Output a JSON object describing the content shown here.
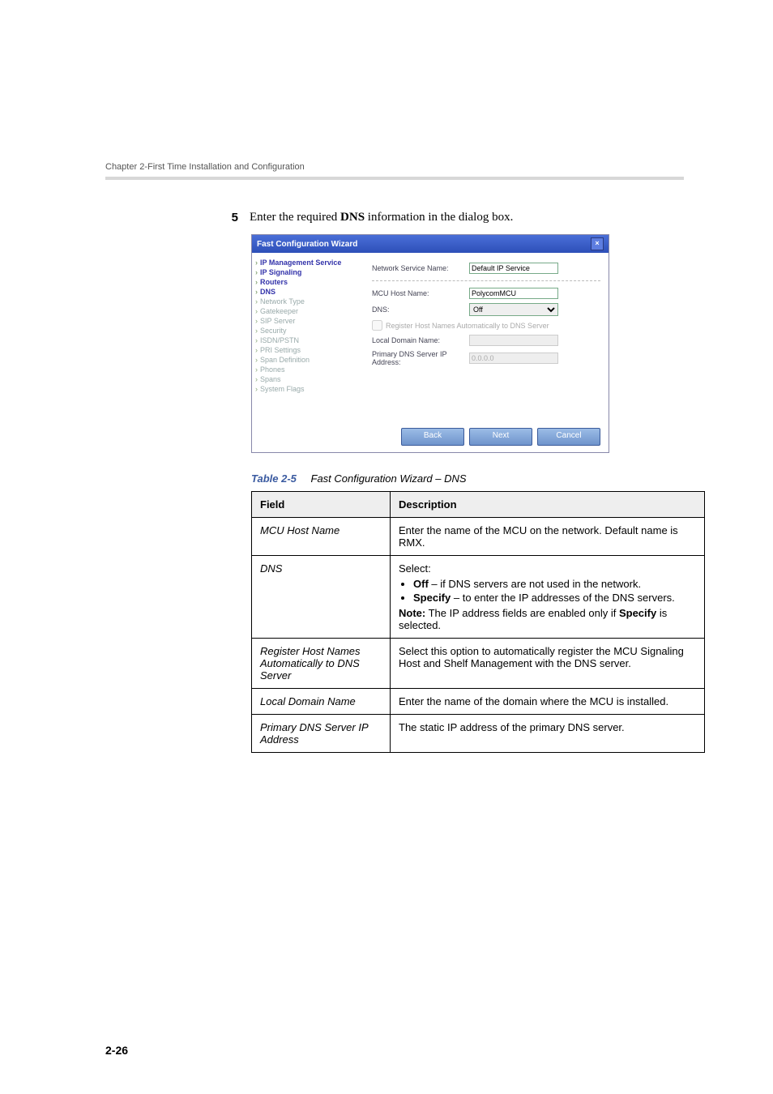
{
  "header": {
    "running_head": "Chapter 2-First Time Installation and Configuration"
  },
  "step": {
    "number": "5",
    "pre": "Enter the required ",
    "bold": "DNS",
    "post": " information in the dialog box."
  },
  "wizard": {
    "title": "Fast Configuration Wizard",
    "close": "×",
    "nav": [
      {
        "label": "IP Management Service",
        "state": "active"
      },
      {
        "label": "IP Signaling",
        "state": "active"
      },
      {
        "label": "Routers",
        "state": "active"
      },
      {
        "label": "DNS",
        "state": "current"
      },
      {
        "label": "Network Type",
        "state": ""
      },
      {
        "label": "Gatekeeper",
        "state": ""
      },
      {
        "label": "SIP Server",
        "state": ""
      },
      {
        "label": "Security",
        "state": ""
      },
      {
        "label": "ISDN/PSTN",
        "state": ""
      },
      {
        "label": "PRI Settings",
        "state": ""
      },
      {
        "label": "Span Definition",
        "state": ""
      },
      {
        "label": "Phones",
        "state": ""
      },
      {
        "label": "Spans",
        "state": ""
      },
      {
        "label": "System Flags",
        "state": ""
      }
    ],
    "form": {
      "svc_label": "Network Service Name:",
      "svc_value": "Default IP Service",
      "mcu_label": "MCU Host Name:",
      "mcu_value": "PolycomMCU",
      "dns_label": "DNS:",
      "dns_value": "Off",
      "chk_label": "Register Host Names Automatically to DNS Server",
      "dom_label": "Local Domain Name:",
      "dom_value": "",
      "pri_label": "Primary DNS Server IP Address:",
      "pri_value": "0.0.0.0"
    },
    "footer": {
      "back": "Back",
      "next": "Next",
      "cancel": "Cancel"
    }
  },
  "caption": {
    "label": "Table 2-5",
    "title": "Fast Configuration Wizard – DNS"
  },
  "table": {
    "head_field": "Field",
    "head_desc": "Description",
    "rows": [
      {
        "field": "MCU Host Name",
        "desc_plain": "Enter the name of the MCU on the network. Default name is RMX."
      },
      {
        "field": "DNS",
        "select_label": "Select:",
        "bullet1_b": "Off",
        "bullet1_t": " – if DNS servers are not used in the network.",
        "bullet2_b": "Specify",
        "bullet2_t": " – to enter the IP addresses of the DNS servers.",
        "note_b": "Note:",
        "note_t1": " The IP address fields are enabled only if ",
        "note_b2": "Specify",
        "note_t2": " is selected."
      },
      {
        "field": "Register Host Names Automatically to DNS Server",
        "desc_plain": "Select this option to automatically register the MCU Signaling Host and Shelf Management with the DNS server."
      },
      {
        "field": "Local Domain Name",
        "desc_plain": "Enter the name of the domain where the MCU is installed."
      },
      {
        "field": "Primary DNS Server IP Address",
        "desc_plain": "The static IP address of the primary DNS server."
      }
    ]
  },
  "page_number": "2-26"
}
